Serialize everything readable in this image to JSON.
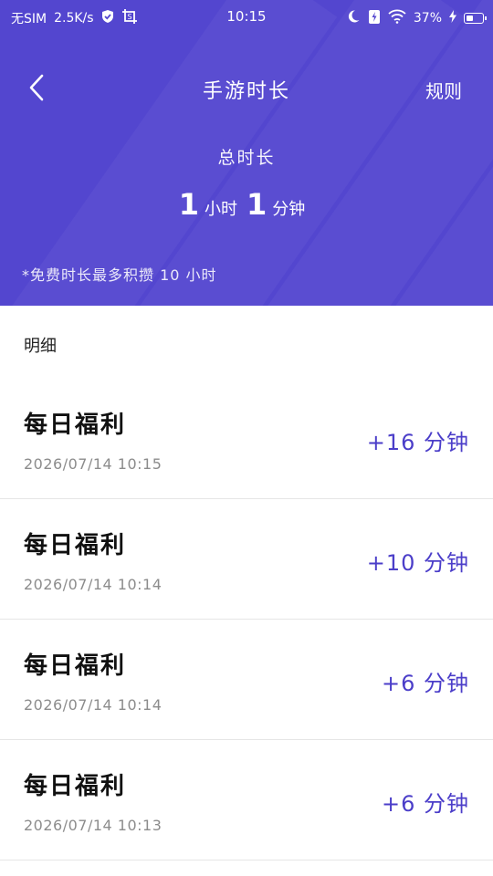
{
  "status_bar": {
    "carrier": "无SIM",
    "speed": "2.5K/s",
    "time": "10:15",
    "battery": "37%",
    "icons": [
      "shield-check-icon",
      "screenshot-icon",
      "moon-icon",
      "battery-saver-icon",
      "wifi-icon",
      "charging-icon",
      "battery-icon"
    ]
  },
  "header": {
    "title": "手游时长",
    "rules_label": "规则",
    "total_label": "总时长",
    "hours": "1",
    "hours_unit": "小时",
    "minutes": "1",
    "minutes_unit": "分钟",
    "note": "*免费时长最多积攒 10 小时",
    "background_color": "#5346cf"
  },
  "detail": {
    "title": "明细",
    "items": [
      {
        "name": "每日福利",
        "time": "2026/07/14 10:15",
        "gain": "+16 分钟"
      },
      {
        "name": "每日福利",
        "time": "2026/07/14 10:14",
        "gain": "+10 分钟"
      },
      {
        "name": "每日福利",
        "time": "2026/07/14 10:14",
        "gain": "+6 分钟"
      },
      {
        "name": "每日福利",
        "time": "2026/07/14 10:13",
        "gain": "+6 分钟"
      }
    ],
    "accent_color": "#4b3ec9"
  }
}
